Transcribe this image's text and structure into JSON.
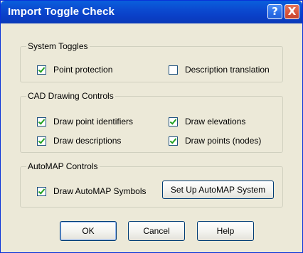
{
  "window": {
    "title": "Import Toggle Check",
    "help_glyph": "?",
    "close_glyph": "X"
  },
  "system_toggles": {
    "legend": "System Toggles",
    "point_protection": {
      "label": "Point protection",
      "checked": true
    },
    "description_translation": {
      "label": "Description translation",
      "checked": false
    }
  },
  "cad_controls": {
    "legend": "CAD Drawing Controls",
    "draw_point_identifiers": {
      "label": "Draw point identifiers",
      "checked": true
    },
    "draw_elevations": {
      "label": "Draw elevations",
      "checked": true
    },
    "draw_descriptions": {
      "label": "Draw descriptions",
      "checked": true
    },
    "draw_points_nodes": {
      "label": "Draw points (nodes)",
      "checked": true
    }
  },
  "automap_controls": {
    "legend": "AutoMAP Controls",
    "draw_symbols": {
      "label": "Draw AutoMAP Symbols",
      "checked": true
    },
    "setup_button": "Set Up AutoMAP System"
  },
  "buttons": {
    "ok": "OK",
    "cancel": "Cancel",
    "help": "Help"
  },
  "colors": {
    "titlebar": "#0a4fd4",
    "dialog_bg": "#ece9d8",
    "checkmark": "#21a121",
    "close_button": "#d8533a"
  }
}
